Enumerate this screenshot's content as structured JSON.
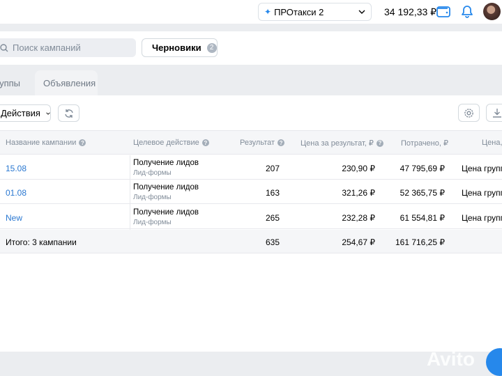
{
  "topbar": {
    "account_name": "ПРОтакси 2",
    "balance": "34 192,33 ₽",
    "icons": [
      "sparkle-icon",
      "chevron-down-icon",
      "wallet-icon",
      "bell-icon"
    ]
  },
  "toolbar": {
    "search_placeholder": "Поиск кампаний",
    "drafts_label": "Черновики",
    "drafts_count": "2"
  },
  "tabs": [
    {
      "label": "руппы"
    },
    {
      "label": "Объявления",
      "active": true
    }
  ],
  "actions": {
    "label": "Действия"
  },
  "table": {
    "headers": {
      "name": "Название кампании",
      "action": "Целевое действие",
      "result": "Результат",
      "price": "Цена за результат, ₽",
      "spent": "Потрачено, ₽",
      "bid": "Цена,"
    },
    "rows": [
      {
        "name": "15.08",
        "action": "Получение лидов",
        "action_sub": "Лид-формы",
        "result": "207",
        "price": "230,90 ₽",
        "spent": "47 795,69 ₽",
        "bid": "Цена группы"
      },
      {
        "name": "01.08",
        "action": "Получение лидов",
        "action_sub": "Лид-формы",
        "result": "163",
        "price": "321,26 ₽",
        "spent": "52 365,75 ₽",
        "bid": "Цена группы"
      },
      {
        "name": "New",
        "action": "Получение лидов",
        "action_sub": "Лид-формы",
        "result": "265",
        "price": "232,28 ₽",
        "spent": "61 554,81 ₽",
        "bid": "Цена группы"
      }
    ],
    "total": {
      "label": "Итого: 3 кампании",
      "result": "635",
      "price": "254,67 ₽",
      "spent": "161 716,25 ₽"
    }
  },
  "watermark": "Avito",
  "colors": {
    "accent": "#2688eb",
    "link": "#2a78d1",
    "muted": "#818c99"
  }
}
